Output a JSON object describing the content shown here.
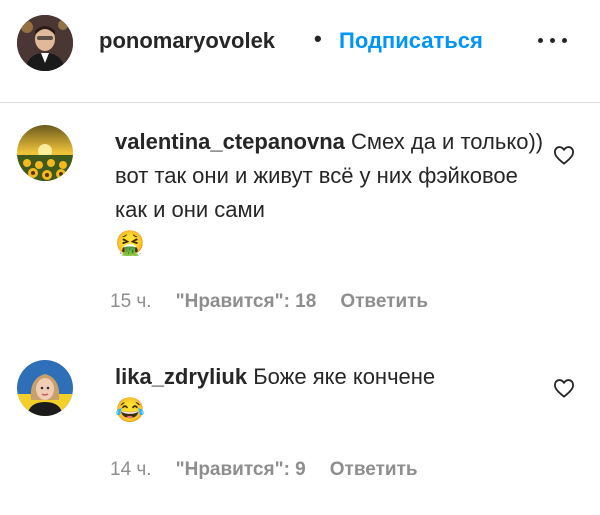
{
  "header": {
    "username": "ponomaryovolek",
    "separator": "•",
    "follow_label": "Подписаться"
  },
  "comments": [
    {
      "username": "valentina_ctepanovna",
      "text": "Смех да и только)) вот так они и живут всё у них фэйковое как и они сами",
      "emoji": "🤮",
      "time": "15 ч.",
      "likes": "\"Нравится\": 18",
      "reply_label": "Ответить"
    },
    {
      "username": "lika_zdryliuk",
      "text": "Боже яке кончене",
      "emoji": "😂",
      "time": "14 ч.",
      "likes": "\"Нравится\": 9",
      "reply_label": "Ответить"
    }
  ],
  "colors": {
    "accent": "#0095f6",
    "text": "#262626",
    "muted": "#8e8e8e",
    "divider": "#dbdbdb"
  },
  "icons": {
    "more": "more-options-icon",
    "like": "heart-icon"
  }
}
